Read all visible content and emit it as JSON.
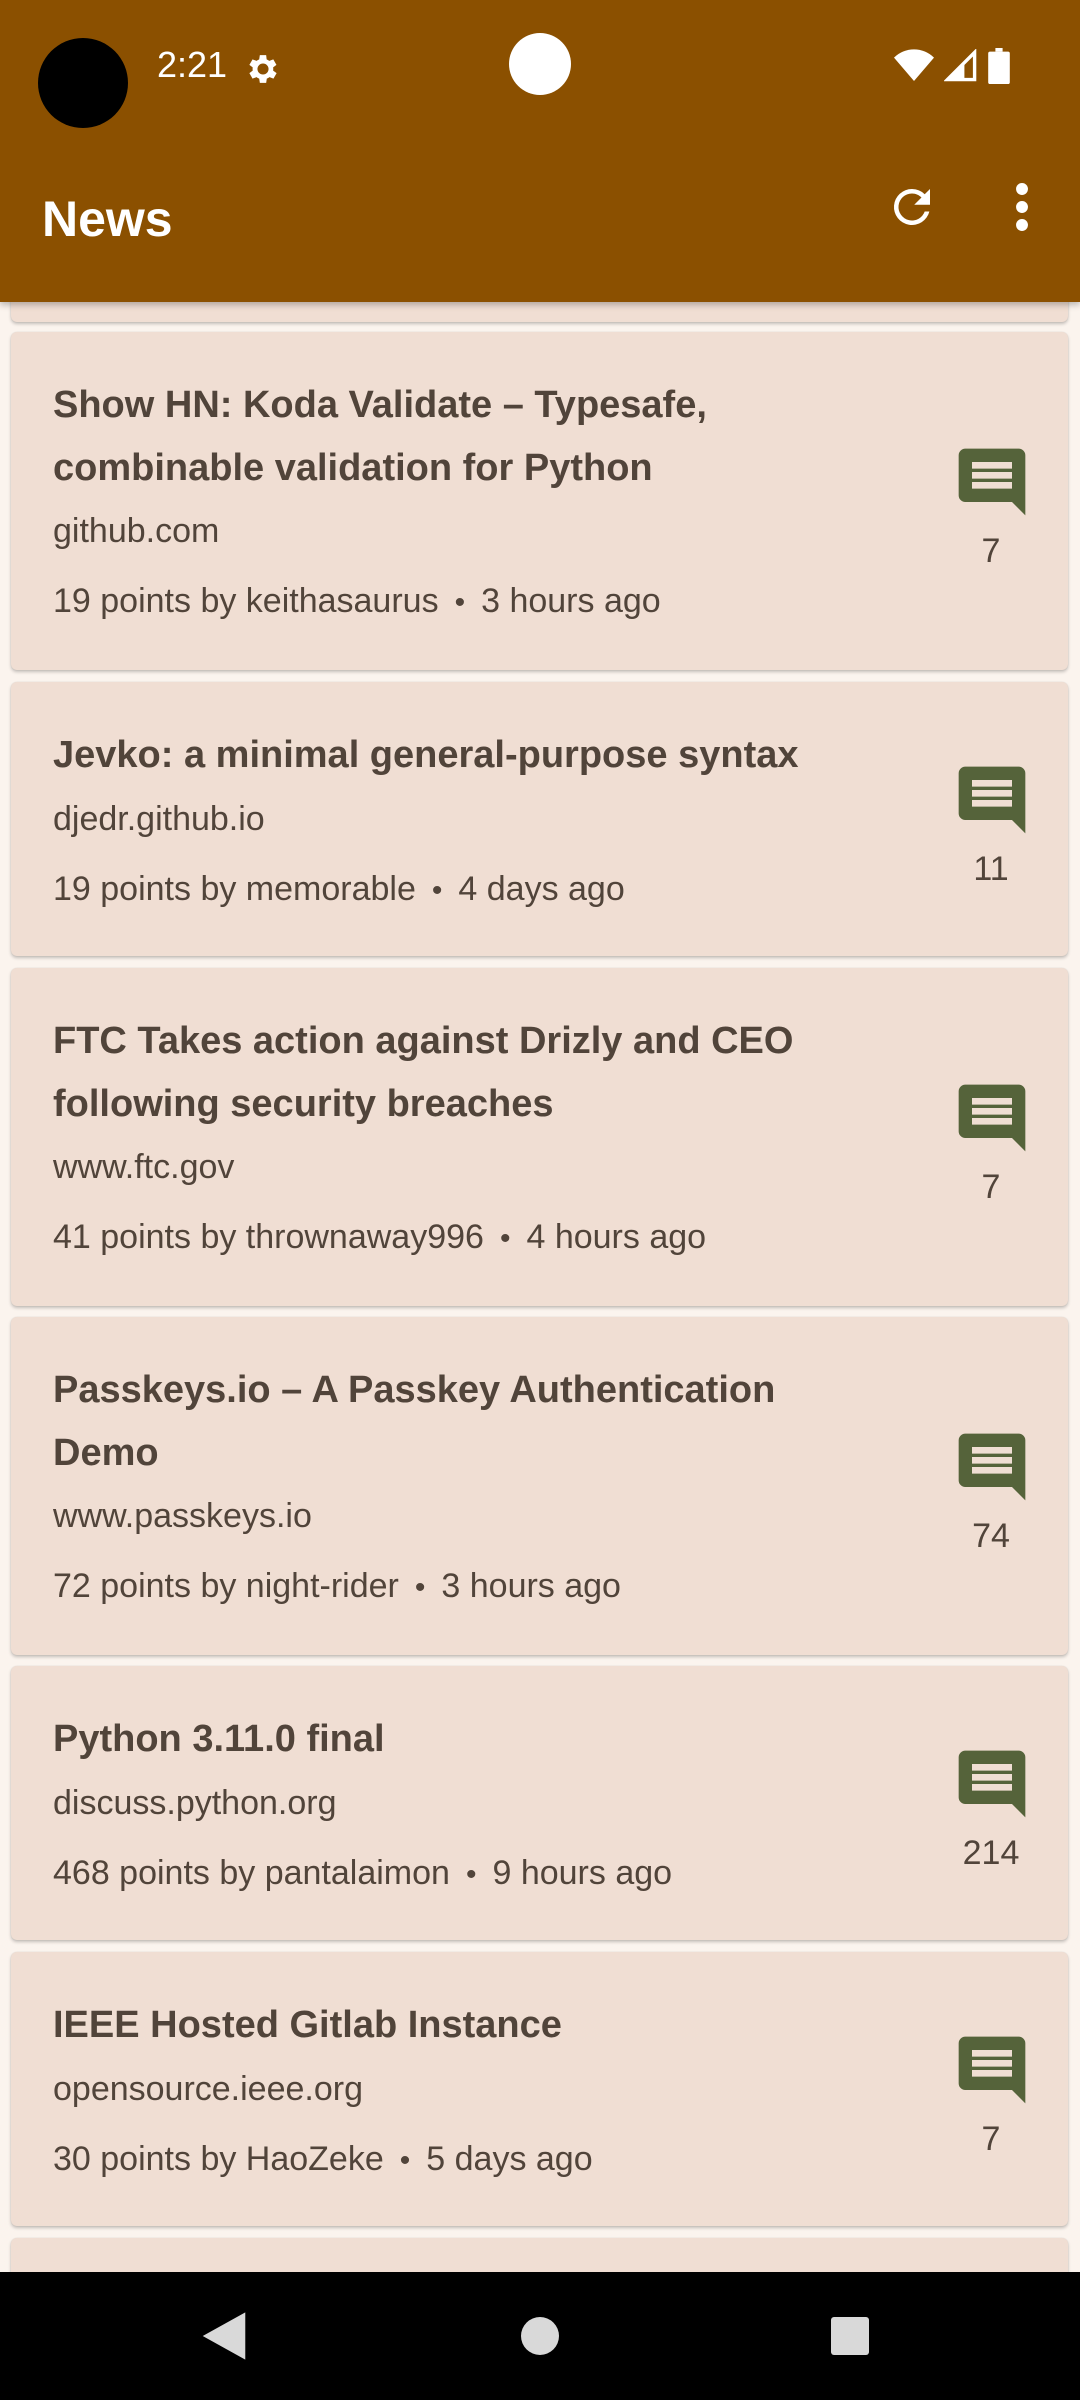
{
  "status_bar": {
    "time": "2:21",
    "icons": [
      "settings-gear-icon",
      "wifi-icon",
      "signal-icon",
      "battery-icon"
    ]
  },
  "toolbar": {
    "title": "News",
    "actions": [
      "refresh-icon",
      "more-vert-icon"
    ]
  },
  "colors": {
    "appbar": "#8b5000",
    "card": "#f0ded3",
    "text": "#51443a",
    "comment_icon": "#55633a"
  },
  "stories": [
    {
      "title": "Show HN: Koda Validate – Typesafe, combinable validation for Python",
      "domain": "github.com",
      "points_by": "19 points by keithasaurus",
      "time": "3 hours ago",
      "comments": "7"
    },
    {
      "title": "Jevko: a minimal general-purpose syntax",
      "domain": "djedr.github.io",
      "points_by": "19 points by memorable",
      "time": "4 days ago",
      "comments": "11"
    },
    {
      "title": "FTC Takes action against Drizly and CEO following security breaches",
      "domain": "www.ftc.gov",
      "points_by": "41 points by thrownaway996",
      "time": "4 hours ago",
      "comments": "7"
    },
    {
      "title": "Passkeys.io – A Passkey Authentication Demo",
      "domain": "www.passkeys.io",
      "points_by": "72 points by night-rider",
      "time": "3 hours ago",
      "comments": "74"
    },
    {
      "title": "Python 3.11.0 final",
      "domain": "discuss.python.org",
      "points_by": "468 points by pantalaimon",
      "time": "9 hours ago",
      "comments": "214"
    },
    {
      "title": "IEEE Hosted Gitlab Instance",
      "domain": "opensource.ieee.org",
      "points_by": "30 points by HaoZeke",
      "time": "5 days ago",
      "comments": "7"
    }
  ],
  "separator": "•"
}
